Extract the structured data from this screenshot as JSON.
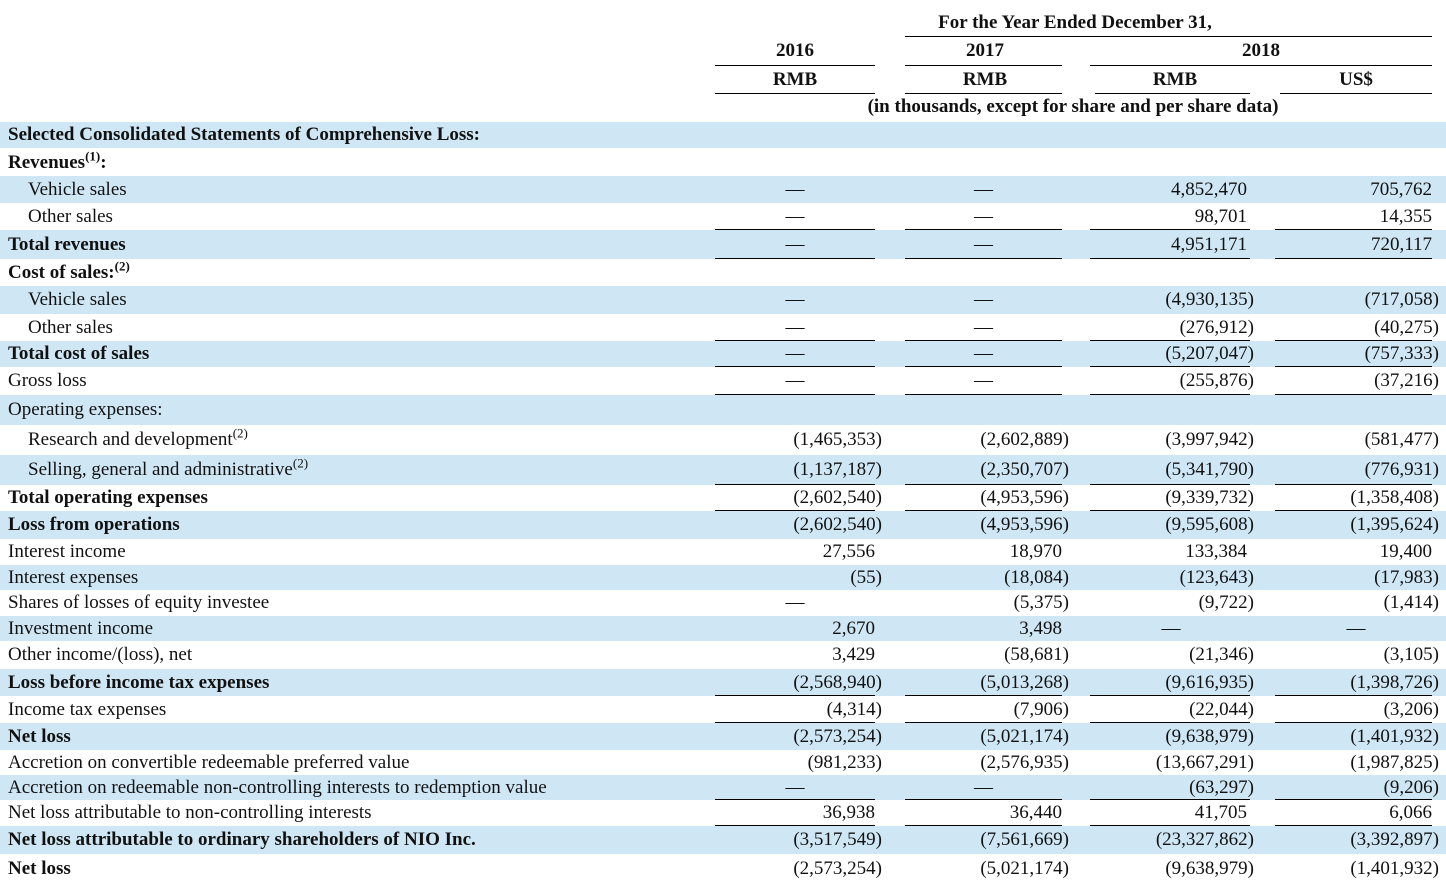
{
  "header": {
    "period": "For the Year Ended December 31,",
    "years": [
      "2016",
      "2017",
      "2018"
    ],
    "currencies": [
      "RMB",
      "RMB",
      "RMB",
      "US$"
    ],
    "unit_note": "(in thousands, except for share and per share data)"
  },
  "table": {
    "rows": [
      {
        "label": "Selected Consolidated Statements of Comprehensive Loss:",
        "sup": "",
        "bold": true,
        "indent": false,
        "values": [
          "",
          "",
          "",
          ""
        ]
      },
      {
        "label": "Revenues",
        "sup": "(1)",
        "suffix": ":",
        "bold": true,
        "indent": false,
        "values": [
          "",
          "",
          "",
          ""
        ]
      },
      {
        "label": "Vehicle sales",
        "sup": "",
        "bold": false,
        "indent": true,
        "values": [
          "—",
          "—",
          "4,852,470",
          "705,762"
        ]
      },
      {
        "label": "Other sales",
        "sup": "",
        "bold": false,
        "indent": true,
        "values": [
          "—",
          "—",
          "98,701",
          "14,355"
        ]
      },
      {
        "label": "Total revenues",
        "sup": "",
        "bold": true,
        "indent": false,
        "values": [
          "—",
          "—",
          "4,951,171",
          "720,117"
        ]
      },
      {
        "label": "Cost of sales:",
        "sup": "(2)",
        "bold": true,
        "indent": false,
        "values": [
          "",
          "",
          "",
          ""
        ]
      },
      {
        "label": "Vehicle sales",
        "sup": "",
        "bold": false,
        "indent": true,
        "values": [
          "—",
          "—",
          "(4,930,135)",
          "(717,058)"
        ]
      },
      {
        "label": "Other sales",
        "sup": "",
        "bold": false,
        "indent": true,
        "values": [
          "—",
          "—",
          "(276,912)",
          "(40,275)"
        ]
      },
      {
        "label": "Total cost of sales",
        "sup": "",
        "bold": true,
        "indent": false,
        "values": [
          "—",
          "—",
          "(5,207,047)",
          "(757,333)"
        ]
      },
      {
        "label": "Gross loss",
        "sup": "",
        "bold": false,
        "indent": false,
        "values": [
          "—",
          "—",
          "(255,876)",
          "(37,216)"
        ]
      },
      {
        "label": "Operating expenses:",
        "sup": "",
        "bold": false,
        "indent": false,
        "values": [
          "",
          "",
          "",
          ""
        ]
      },
      {
        "label": "Research and development",
        "sup": "(2)",
        "bold": false,
        "indent": true,
        "values": [
          "(1,465,353)",
          "(2,602,889)",
          "(3,997,942)",
          "(581,477)"
        ]
      },
      {
        "label": "Selling, general and administrative",
        "sup": "(2)",
        "bold": false,
        "indent": true,
        "values": [
          "(1,137,187)",
          "(2,350,707)",
          "(5,341,790)",
          "(776,931)"
        ]
      },
      {
        "label": "Total operating expenses",
        "sup": "",
        "bold": true,
        "indent": false,
        "values": [
          "(2,602,540)",
          "(4,953,596)",
          "(9,339,732)",
          "(1,358,408)"
        ]
      },
      {
        "label": "Loss from operations",
        "sup": "",
        "bold": true,
        "indent": false,
        "values": [
          "(2,602,540)",
          "(4,953,596)",
          "(9,595,608)",
          "(1,395,624)"
        ]
      },
      {
        "label": "Interest income",
        "sup": "",
        "bold": false,
        "indent": false,
        "values": [
          "27,556",
          "18,970",
          "133,384",
          "19,400"
        ]
      },
      {
        "label": "Interest expenses",
        "sup": "",
        "bold": false,
        "indent": false,
        "values": [
          "(55)",
          "(18,084)",
          "(123,643)",
          "(17,983)"
        ]
      },
      {
        "label": "Shares of losses of equity investee",
        "sup": "",
        "bold": false,
        "indent": false,
        "values": [
          "—",
          "(5,375)",
          "(9,722)",
          "(1,414)"
        ]
      },
      {
        "label": "Investment income",
        "sup": "",
        "bold": false,
        "indent": false,
        "values": [
          "2,670",
          "3,498",
          "—",
          "—"
        ]
      },
      {
        "label": "Other income/(loss), net",
        "sup": "",
        "bold": false,
        "indent": false,
        "values": [
          "3,429",
          "(58,681)",
          "(21,346)",
          "(3,105)"
        ]
      },
      {
        "label": "Loss before income tax expenses",
        "sup": "",
        "bold": true,
        "indent": false,
        "values": [
          "(2,568,940)",
          "(5,013,268)",
          "(9,616,935)",
          "(1,398,726)"
        ]
      },
      {
        "label": "Income tax expenses",
        "sup": "",
        "bold": false,
        "indent": false,
        "values": [
          "(4,314)",
          "(7,906)",
          "(22,044)",
          "(3,206)"
        ]
      },
      {
        "label": "Net loss",
        "sup": "",
        "bold": true,
        "indent": false,
        "values": [
          "(2,573,254)",
          "(5,021,174)",
          "(9,638,979)",
          "(1,401,932)"
        ]
      },
      {
        "label": "Accretion on convertible redeemable preferred value",
        "sup": "",
        "bold": false,
        "indent": false,
        "values": [
          "(981,233)",
          "(2,576,935)",
          "(13,667,291)",
          "(1,987,825)"
        ]
      },
      {
        "label": "Accretion on redeemable non-controlling interests to redemption value",
        "sup": "",
        "bold": false,
        "indent": false,
        "values": [
          "—",
          "—",
          "(63,297)",
          "(9,206)"
        ]
      },
      {
        "label": "Net loss attributable to non-controlling interests",
        "sup": "",
        "bold": false,
        "indent": false,
        "values": [
          "36,938",
          "36,440",
          "41,705",
          "6,066"
        ]
      },
      {
        "label": "Net loss attributable to ordinary shareholders of NIO Inc.",
        "sup": "",
        "bold": true,
        "indent": false,
        "values": [
          "(3,517,549)",
          "(7,561,669)",
          "(23,327,862)",
          "(3,392,897)"
        ]
      },
      {
        "label": "Net loss",
        "sup": "",
        "bold": true,
        "indent": false,
        "values": [
          "(2,573,254)",
          "(5,021,174)",
          "(9,638,979)",
          "(1,401,932)"
        ]
      }
    ]
  }
}
